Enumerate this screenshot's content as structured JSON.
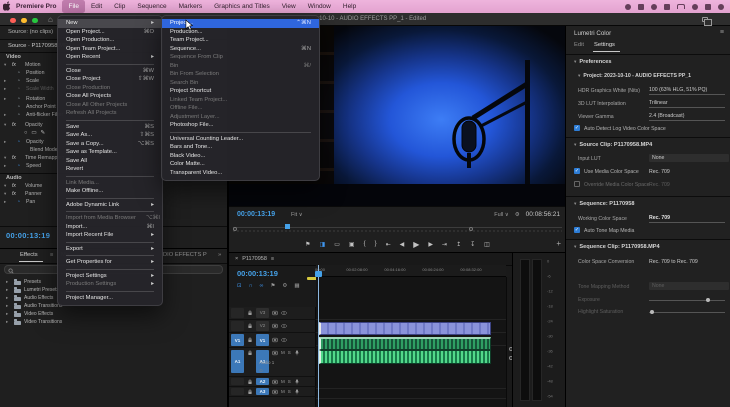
{
  "colors": {
    "accent_blue": "#3f96f0",
    "timecode_blue": "#45a1e8",
    "selection_blue": "#2f66dd",
    "menubar_pink": "#e9aed8",
    "clip_green": "#2f9e63",
    "clip_blue": "#8a93da",
    "work_bar_yellow": "#d6c93e"
  },
  "glyphs": {
    "arrow": "▸",
    "tri_down": "▾",
    "tri_right": "▸",
    "check": "✓",
    "dd": "∨",
    "menu": "≡",
    "close": "×",
    "home": "⌂",
    "chev2": "»",
    "flag": "⚑",
    "wrench": "⚙",
    "cc": "▦",
    "knob": "⊙",
    "dot": "·",
    "plus": "+",
    "fx": "fx",
    "sw": "◔",
    "mask_ellipse": "○",
    "mask_rect": "▭",
    "mask_pen": "✎"
  },
  "menubar": {
    "app_name": "Premiere Pro",
    "items": [
      {
        "label": "File",
        "active": true
      },
      {
        "label": "Edit"
      },
      {
        "label": "Clip"
      },
      {
        "label": "Sequence"
      },
      {
        "label": "Markers"
      },
      {
        "label": "Graphics and Titles"
      },
      {
        "label": "View"
      },
      {
        "label": "Window"
      },
      {
        "label": "Help"
      }
    ],
    "status_icons": [
      "dropbox-icon",
      "stats-icon",
      "media-icon",
      "clock-icon",
      "battery-icon",
      "wifi-icon",
      "search-icon",
      "control-center-icon"
    ]
  },
  "window": {
    "title": "2023-10-10 - AUDIO EFFECTS PP_1 - Edited"
  },
  "file_menu": {
    "items": [
      {
        "label": "New",
        "arrow": "▸"
      },
      {
        "label": "Open Project...",
        "shortcut": "⌘O"
      },
      {
        "label": "Open Production..."
      },
      {
        "label": "Open Team Project..."
      },
      {
        "label": "Open Recent",
        "arrow": "▸"
      },
      {
        "label": "Close",
        "shortcut": "⌘W"
      },
      {
        "label": "Close Project",
        "shortcut": "⇧⌘W"
      },
      {
        "label": "Close Production"
      },
      {
        "label": "Close All Projects"
      },
      {
        "label": "Close All Other Projects"
      },
      {
        "label": "Refresh All Projects"
      },
      {
        "label": "Save",
        "shortcut": "⌘S"
      },
      {
        "label": "Save As...",
        "shortcut": "⇧⌘S"
      },
      {
        "label": "Save a Copy...",
        "shortcut": "⌥⌘S"
      },
      {
        "label": "Save as Template..."
      },
      {
        "label": "Save All"
      },
      {
        "label": "Revert"
      },
      {
        "label": "Link Media..."
      },
      {
        "label": "Make Offline..."
      },
      {
        "label": "Adobe Dynamic Link",
        "arrow": "▸"
      },
      {
        "label": "Import from Media Browser",
        "shortcut": "⌥⌘I"
      },
      {
        "label": "Import...",
        "shortcut": "⌘I"
      },
      {
        "label": "Import Recent File",
        "arrow": "▸"
      },
      {
        "label": "Export",
        "arrow": "▸"
      },
      {
        "label": "Get Properties for",
        "arrow": "▸"
      },
      {
        "label": "Project Settings",
        "arrow": "▸"
      },
      {
        "label": "Production Settings",
        "arrow": "▸"
      },
      {
        "label": "Project Manager..."
      }
    ]
  },
  "new_submenu": {
    "items": [
      {
        "label": "Project...",
        "shortcut": "⌃⌘N"
      },
      {
        "label": "Production..."
      },
      {
        "label": "Team Project..."
      },
      {
        "label": "Sequence...",
        "shortcut": "⌘N"
      },
      {
        "label": "Sequence From Clip"
      },
      {
        "label": "Bin",
        "shortcut": "⌘/"
      },
      {
        "label": "Bin From Selection"
      },
      {
        "label": "Search Bin"
      },
      {
        "label": "Project Shortcut"
      },
      {
        "label": "Linked Team Project..."
      },
      {
        "label": "Offline File..."
      },
      {
        "label": "Adjustment Layer..."
      },
      {
        "label": "Photoshop File..."
      },
      {
        "label": "Universal Counting Leader..."
      },
      {
        "label": "Bars and Tone..."
      },
      {
        "label": "Black Video..."
      },
      {
        "label": "Color Matte..."
      },
      {
        "label": "Transparent Video..."
      }
    ]
  },
  "effect_controls": {
    "tab": "Source: (no clips)",
    "header": "Source · P1170958.MP4",
    "video_label": "Video",
    "audio_label": "Audio",
    "timecode": "00:00:13:19",
    "rows": [
      {
        "tri": "▾",
        "icon": "fx",
        "label": "Motion"
      },
      {
        "tri": "",
        "icon": "◔",
        "label": "Position"
      },
      {
        "tri": "▸",
        "icon": "◔",
        "label": "Scale"
      },
      {
        "tri": "▸",
        "icon": "◔",
        "label": "Scale Width"
      },
      {
        "tri": "▸",
        "icon": "◔",
        "label": "Rotation"
      },
      {
        "tri": "",
        "icon": "◔",
        "label": "Anchor Point"
      },
      {
        "tri": "▸",
        "icon": "◔",
        "label": "Anti-flicker Filter"
      },
      {
        "tri": "▾",
        "icon": "fx",
        "label": "Opacity"
      },
      {
        "tri": "▸",
        "icon": "◔",
        "label": "Opacity"
      },
      {
        "tri": "",
        "icon": "",
        "label": "Blend Mode"
      },
      {
        "tri": "▾",
        "icon": "fx",
        "label": "Time Remapping"
      },
      {
        "tri": "▸",
        "icon": "◔",
        "label": "Speed"
      },
      {
        "tri": "▾",
        "icon": "fx",
        "label": "Volume"
      },
      {
        "tri": "▾",
        "icon": "fx",
        "label": "Panner"
      },
      {
        "tri": "▸",
        "icon": "◔",
        "label": "Pan"
      }
    ]
  },
  "effects_panel": {
    "tab1": "Effects",
    "tab2": "Ma",
    "tab3_fragment": "DIO EFFECTS P",
    "chevron": "»",
    "folders": [
      "Presets",
      "Lumetri Presets",
      "Audio Effects",
      "Audio Transitions",
      "Video Effects",
      "Video Transitions"
    ]
  },
  "program_monitor": {
    "timecode": "00:00:13:19",
    "zoom_level": "Fit",
    "playback_resolution": "Full",
    "duration": "00:08:56:21",
    "transport_icons": [
      {
        "name": "add-marker",
        "g": "⚑"
      },
      {
        "name": "toggle-proxies",
        "g": "◨"
      },
      {
        "name": "safe-margins",
        "g": "▭"
      },
      {
        "name": "export-frame",
        "g": "▣"
      },
      {
        "name": "mark-in",
        "g": "{"
      },
      {
        "name": "mark-out",
        "g": "}"
      },
      {
        "name": "go-to-in",
        "g": "⇤"
      },
      {
        "name": "step-back",
        "g": "◀"
      },
      {
        "name": "play",
        "g": "▶"
      },
      {
        "name": "step-forward",
        "g": "▶"
      },
      {
        "name": "go-to-out",
        "g": "⇥"
      },
      {
        "name": "lift",
        "g": "↥"
      },
      {
        "name": "extract",
        "g": "↧"
      },
      {
        "name": "comparison-view",
        "g": "◫"
      }
    ],
    "plus": "+"
  },
  "timeline": {
    "tab": "P1170958",
    "timecode": "00:00:13:19",
    "tools": [
      {
        "name": "nest-toggle",
        "g": "⊡",
        "blue": true
      },
      {
        "name": "snap",
        "g": "∩",
        "blue": true
      },
      {
        "name": "linked-selection",
        "g": "∞",
        "blue": true
      },
      {
        "name": "add-marker",
        "g": "⚑"
      },
      {
        "name": "timeline-settings",
        "g": "⚙"
      },
      {
        "name": "captions",
        "g": "▦"
      }
    ],
    "ruler_ticks": [
      "00:00",
      "00:02:08:00",
      "00:04:16:00",
      "00:06:24:00",
      "00:08:32:00"
    ],
    "video_tracks": [
      "V3",
      "V2",
      "V1"
    ],
    "audio_tracks": [
      "A1",
      "A2",
      "A3"
    ],
    "source_patch_video": "V1",
    "source_patch_audio": "A1",
    "audio1_label": "Audio 1",
    "mute": "M",
    "solo": "S"
  },
  "meters": {
    "scale": [
      "0",
      "-6",
      "-12",
      "-18",
      "-24",
      "-30",
      "-36",
      "-42",
      "-48",
      "-54"
    ]
  },
  "lumetri": {
    "title": "Lumetri Color",
    "tabs": {
      "edit": "Edit",
      "settings": "Settings"
    },
    "sections": {
      "preferences": "Preferences",
      "project": "Project: 2023-10-10 - AUDIO EFFECTS PP_1",
      "source_clip": "Source Clip: P1170958.MP4",
      "sequence": "Sequence: P1170958",
      "sequence_clip": "Sequence Clip: P1170958.MP4"
    },
    "rows": {
      "hdr_white": {
        "label": "HDR Graphics White (Nits)",
        "value": "100 (63% HLG, 51% PQ)"
      },
      "lut_interp": {
        "label": "3D LUT Interpolation",
        "value": "Trilinear"
      },
      "viewer_gamma": {
        "label": "Viewer Gamma",
        "value": "2.4 (Broadcast)"
      },
      "auto_detect": {
        "label": "Auto Detect Log Video Color Space"
      },
      "input_lut": {
        "label": "Input LUT",
        "value": "None"
      },
      "use_media": {
        "label": "Use Media Color Space",
        "value": "Rec. 709"
      },
      "override_media": {
        "label": "Override Media Color Space",
        "value": "Rec. 709"
      },
      "working_cs": {
        "label": "Working Color Space",
        "value": "Rec. 709"
      },
      "auto_tone": {
        "label": "Auto Tone Map Media"
      },
      "cs_conversion": {
        "label": "Color Space Conversion",
        "value": "Rec. 709 to Rec. 709"
      },
      "tone_mapping": {
        "label": "Tone Mapping Method",
        "value": "None"
      },
      "exposure": {
        "label": "Exposure"
      },
      "highlight_sat": {
        "label": "Highlight Saturation"
      }
    }
  }
}
